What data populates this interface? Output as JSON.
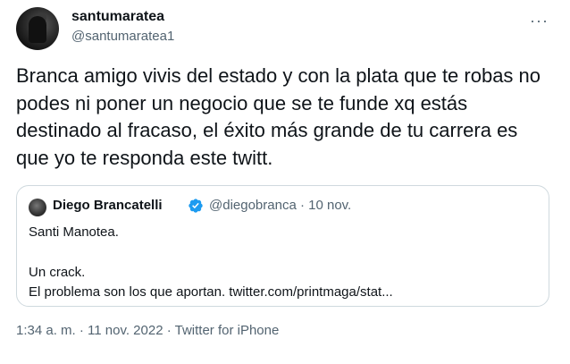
{
  "author": {
    "display_name": "santumaratea",
    "handle": "@santumaratea1",
    "avatar_icon": "user-avatar"
  },
  "more_icon": "more-options-icon",
  "more_label": "···",
  "tweet_text": "Branca amigo vivis del estado y con la plata que te robas no podes ni poner un negocio que se te funde xq estás destinado al fracaso, el éxito más grande de tu carrera es que yo te responda este twitt.",
  "quoted": {
    "display_name": "Diego Brancatelli",
    "verified": true,
    "verified_color": "#1d9bf0",
    "handle_date": "@diegobranca · 10 nov.",
    "lines": [
      "Santi Manotea.",
      "Un crack.",
      "El problema son los que aportan. twitter.com/printmaga/stat..."
    ]
  },
  "meta": {
    "timestamp_source": "1:34 a. m. · 11 nov. 2022 · Twitter for iPhone"
  },
  "colors": {
    "text": "#0f1419",
    "secondary": "#536471",
    "border": "#cfd9de"
  }
}
